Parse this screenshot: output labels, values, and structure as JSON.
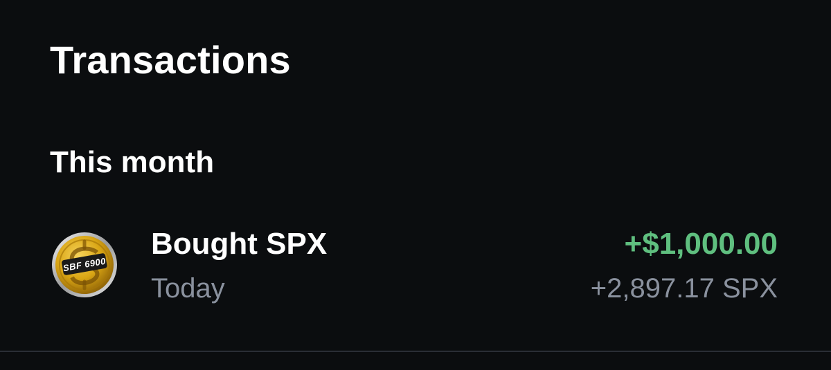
{
  "header": {
    "title": "Transactions"
  },
  "section": {
    "title": "This month"
  },
  "transactions": [
    {
      "title": "Bought SPX",
      "date": "Today",
      "fiat_amount": "+$1,000.00",
      "crypto_amount": "+2,897.17 SPX",
      "icon": "spx-coin-icon",
      "icon_text": "SBF 6900"
    }
  ],
  "colors": {
    "background": "#0b0d0f",
    "positive": "#5fbf7f",
    "secondary_text": "#8a919e",
    "divider": "#2a2e35",
    "coin_gold": "#d9a514"
  }
}
